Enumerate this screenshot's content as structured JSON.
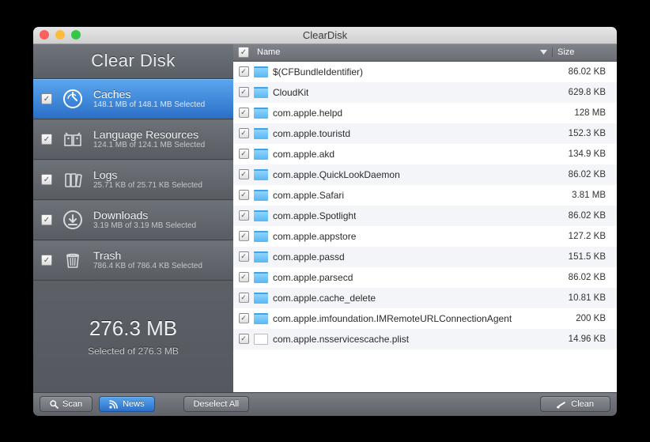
{
  "window": {
    "title": "ClearDisk",
    "brand": "Clear Disk"
  },
  "categories": [
    {
      "name": "Caches",
      "sub": "148.1 MB of 148.1 MB Selected",
      "selected": true
    },
    {
      "name": "Language Resources",
      "sub": "124.1 MB of 124.1 MB Selected",
      "selected": false
    },
    {
      "name": "Logs",
      "sub": "25.71 KB of 25.71 KB Selected",
      "selected": false
    },
    {
      "name": "Downloads",
      "sub": "3.19 MB of 3.19 MB Selected",
      "selected": false
    },
    {
      "name": "Trash",
      "sub": "786.4 KB of 786.4 KB Selected",
      "selected": false
    }
  ],
  "summary": {
    "big": "276.3 MB",
    "small": "Selected of 276.3 MB"
  },
  "table": {
    "cols": {
      "name": "Name",
      "size": "Size"
    },
    "rows": [
      {
        "name": "$(CFBundleIdentifier)",
        "size": "86.02 KB",
        "type": "folder"
      },
      {
        "name": "CloudKit",
        "size": "629.8 KB",
        "type": "folder"
      },
      {
        "name": "com.apple.helpd",
        "size": "128 MB",
        "type": "folder"
      },
      {
        "name": "com.apple.touristd",
        "size": "152.3 KB",
        "type": "folder"
      },
      {
        "name": "com.apple.akd",
        "size": "134.9 KB",
        "type": "folder"
      },
      {
        "name": "com.apple.QuickLookDaemon",
        "size": "86.02 KB",
        "type": "folder"
      },
      {
        "name": "com.apple.Safari",
        "size": "3.81 MB",
        "type": "folder"
      },
      {
        "name": "com.apple.Spotlight",
        "size": "86.02 KB",
        "type": "folder"
      },
      {
        "name": "com.apple.appstore",
        "size": "127.2 KB",
        "type": "folder"
      },
      {
        "name": "com.apple.passd",
        "size": "151.5 KB",
        "type": "folder"
      },
      {
        "name": "com.apple.parsecd",
        "size": "86.02 KB",
        "type": "folder"
      },
      {
        "name": "com.apple.cache_delete",
        "size": "10.81 KB",
        "type": "folder"
      },
      {
        "name": "com.apple.imfoundation.IMRemoteURLConnectionAgent",
        "size": "200 KB",
        "type": "folder"
      },
      {
        "name": "com.apple.nsservicescache.plist",
        "size": "14.96 KB",
        "type": "file"
      }
    ]
  },
  "footer": {
    "scan": "Scan",
    "news": "News",
    "deselect": "Deselect All",
    "clean": "Clean"
  },
  "glyphs": {
    "check": "✓"
  }
}
